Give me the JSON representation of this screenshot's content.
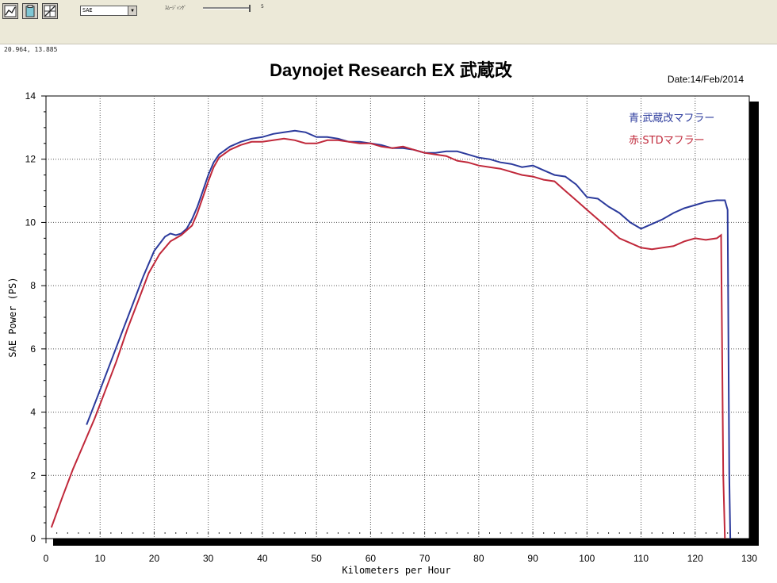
{
  "toolbar": {
    "icons": [
      "chart-tool-icon",
      "clipboard-icon",
      "graph-settings-icon"
    ],
    "sae_select": "SAE",
    "smoothing_label": "ｽﾑｰｼﾞｨﾝｸﾞ",
    "smoothing_value": "5"
  },
  "cursor_readout": "20.964, 13.885",
  "chart_data": {
    "type": "line",
    "title": "Daynojet Research EX 武蔵改",
    "date": "Date:14/Feb/2014",
    "xlabel": "Kilometers per Hour",
    "ylabel": "SAE Power (PS)",
    "xlim": [
      0,
      130
    ],
    "ylim": [
      0,
      14
    ],
    "xticks": [
      "0",
      "10",
      "20",
      "30",
      "40",
      "50",
      "60",
      "70",
      "80",
      "90",
      "100",
      "110",
      "120",
      "130"
    ],
    "yticks": [
      "0",
      "2",
      "4",
      "6",
      "8",
      "10",
      "12",
      "14"
    ],
    "grid": true,
    "legend_position": "top-right",
    "series": [
      {
        "name": "青:武蔵改マフラー",
        "color": "#2b3a9c",
        "x": [
          7.5,
          10,
          12,
          14,
          16,
          18,
          20,
          22,
          23,
          24,
          25,
          26,
          27,
          28,
          29,
          30,
          31,
          32,
          34,
          36,
          38,
          40,
          42,
          44,
          46,
          48,
          50,
          52,
          54,
          56,
          58,
          60,
          62,
          64,
          66,
          68,
          70,
          72,
          74,
          76,
          78,
          80,
          82,
          84,
          86,
          88,
          90,
          92,
          94,
          96,
          98,
          100,
          102,
          104,
          106,
          108,
          110,
          112,
          114,
          116,
          118,
          120,
          122,
          124,
          125.5,
          126,
          126.3,
          126.5
        ],
        "y": [
          3.6,
          4.7,
          5.6,
          6.5,
          7.4,
          8.3,
          9.1,
          9.55,
          9.65,
          9.6,
          9.65,
          9.8,
          10.1,
          10.5,
          11.0,
          11.5,
          11.9,
          12.15,
          12.4,
          12.55,
          12.65,
          12.7,
          12.8,
          12.85,
          12.9,
          12.85,
          12.7,
          12.7,
          12.65,
          12.55,
          12.55,
          12.5,
          12.45,
          12.35,
          12.35,
          12.3,
          12.2,
          12.2,
          12.25,
          12.25,
          12.15,
          12.05,
          12.0,
          11.9,
          11.85,
          11.75,
          11.8,
          11.65,
          11.5,
          11.45,
          11.2,
          10.8,
          10.75,
          10.5,
          10.3,
          10.0,
          9.8,
          9.95,
          10.1,
          10.3,
          10.45,
          10.55,
          10.65,
          10.7,
          10.7,
          10.4,
          2.0,
          0.0
        ]
      },
      {
        "name": "赤:STDマフラー",
        "color": "#c0283a",
        "x": [
          1,
          3,
          5,
          7,
          9,
          11,
          13,
          15,
          17,
          19,
          21,
          23,
          25,
          27,
          28,
          29,
          30,
          31,
          32,
          34,
          36,
          38,
          40,
          42,
          44,
          46,
          48,
          50,
          52,
          54,
          56,
          58,
          60,
          62,
          64,
          66,
          68,
          70,
          72,
          74,
          76,
          78,
          80,
          82,
          84,
          86,
          88,
          90,
          92,
          94,
          96,
          98,
          100,
          102,
          104,
          106,
          108,
          110,
          112,
          114,
          116,
          118,
          120,
          122,
          124,
          124.8,
          125.2,
          125.5
        ],
        "y": [
          0.35,
          1.3,
          2.2,
          3.0,
          3.8,
          4.7,
          5.6,
          6.6,
          7.5,
          8.4,
          9.0,
          9.4,
          9.6,
          9.9,
          10.3,
          10.8,
          11.3,
          11.75,
          12.05,
          12.3,
          12.45,
          12.55,
          12.55,
          12.6,
          12.65,
          12.6,
          12.5,
          12.5,
          12.6,
          12.6,
          12.55,
          12.5,
          12.5,
          12.4,
          12.35,
          12.4,
          12.3,
          12.2,
          12.15,
          12.1,
          11.95,
          11.9,
          11.8,
          11.75,
          11.7,
          11.6,
          11.5,
          11.45,
          11.35,
          11.3,
          11.0,
          10.7,
          10.4,
          10.1,
          9.8,
          9.5,
          9.35,
          9.2,
          9.15,
          9.2,
          9.25,
          9.4,
          9.5,
          9.45,
          9.5,
          9.6,
          2.0,
          0.0
        ]
      }
    ]
  }
}
